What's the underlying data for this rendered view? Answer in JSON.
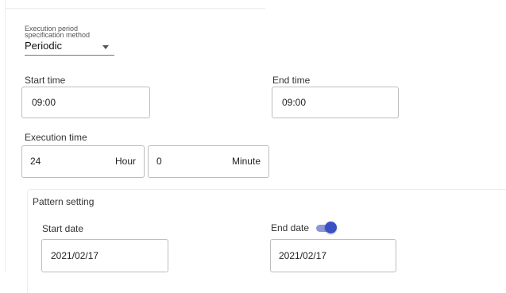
{
  "execution_method": {
    "label": "Execution period specification method",
    "value": "Periodic"
  },
  "start_time": {
    "label": "Start time",
    "value": "09:00"
  },
  "end_time": {
    "label": "End time",
    "value": "09:00"
  },
  "execution_time": {
    "label": "Execution time",
    "hours": "24",
    "hour_unit": "Hour",
    "minutes": "0",
    "minute_unit": "Minute"
  },
  "pattern": {
    "title": "Pattern setting",
    "start_date": {
      "label": "Start date",
      "value": "2021/02/17"
    },
    "end_date": {
      "label": "End date",
      "value": "2021/02/17",
      "enabled": true
    }
  },
  "colors": {
    "toggle_thumb": "#3b50c4",
    "toggle_track": "#8b97d8",
    "border": "#bdbdbd"
  }
}
